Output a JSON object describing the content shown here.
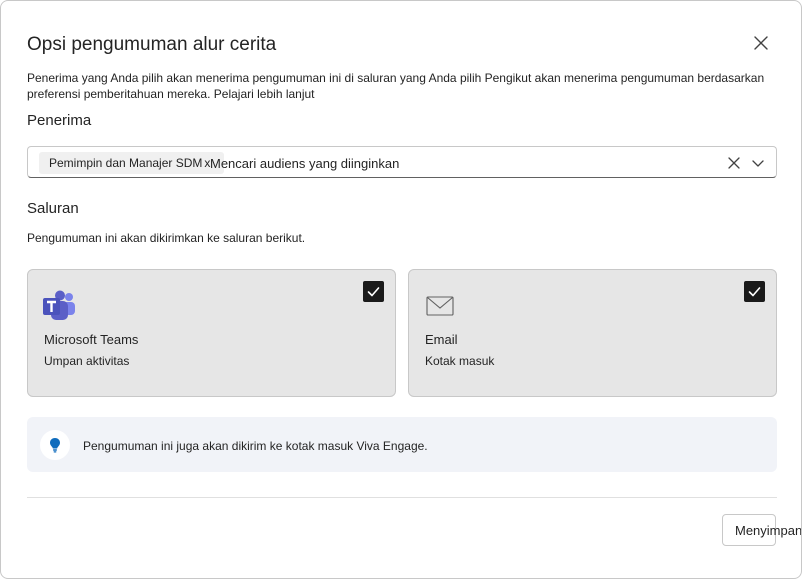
{
  "dialog": {
    "title": "Opsi pengumuman alur cerita",
    "description": "Penerima yang Anda pilih akan menerima pengumuman ini di saluran yang Anda pilih Pengikut akan menerima pengumuman berdasarkan preferensi pemberitahuan mereka.",
    "learn_more": "Pelajari lebih lanjut"
  },
  "recipients": {
    "label": "Penerima",
    "chip_label": "Pemimpin dan Manajer SDM",
    "chip_remove": "x",
    "search_placeholder": "Mencari audiens yang diinginkan"
  },
  "channels": {
    "label": "Saluran",
    "description": "Pengumuman ini akan dikirimkan ke saluran berikut.",
    "items": [
      {
        "title": "Microsoft Teams",
        "subtitle": "Umpan aktivitas",
        "checked": true,
        "icon": "microsoft-teams-icon"
      },
      {
        "title": "Email",
        "subtitle": "Kotak masuk",
        "checked": true,
        "icon": "envelope-icon"
      }
    ]
  },
  "info": {
    "text": "Pengumuman ini juga akan dikirim ke kotak masuk Viva Engage.",
    "icon": "lightbulb-icon"
  },
  "footer": {
    "save_label": "Menyimpan"
  },
  "colors": {
    "teams_purple": "#5b5fc7",
    "info_icon_blue": "#0f6cbd",
    "card_background": "#e6e6e6",
    "info_background": "#f1f3f8"
  }
}
